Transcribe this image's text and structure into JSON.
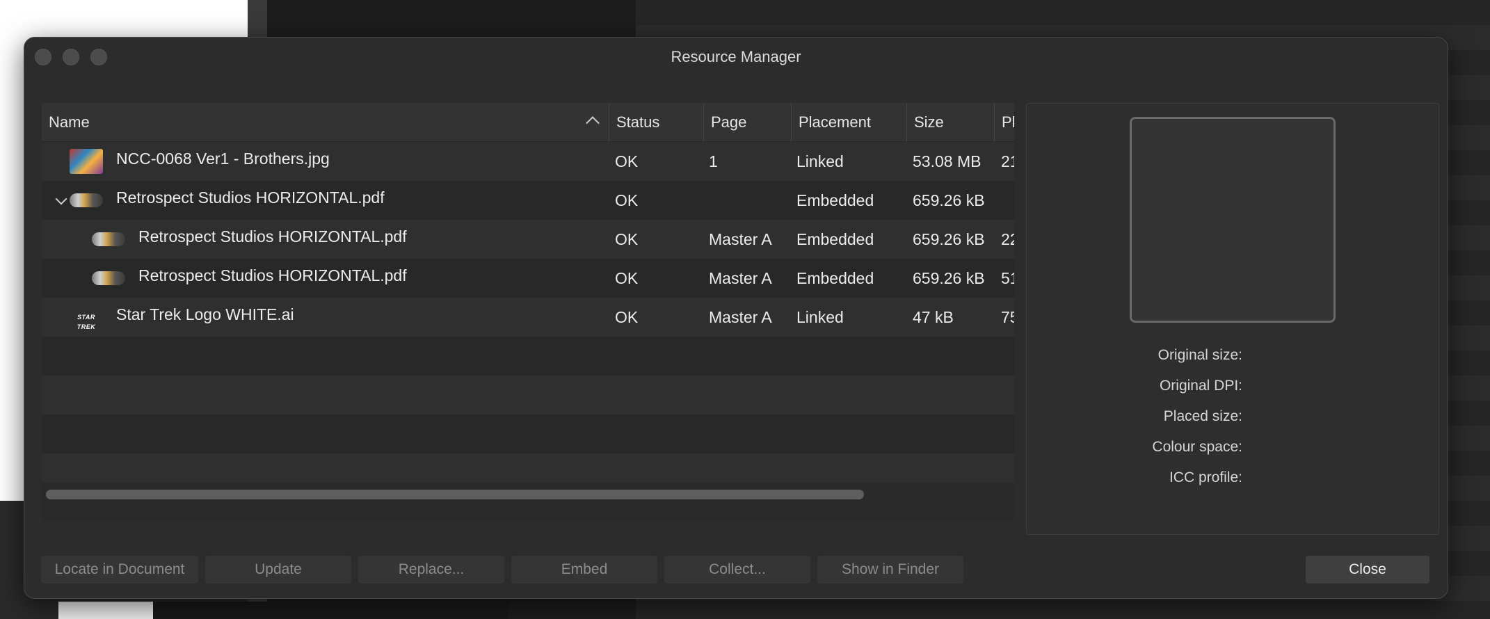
{
  "window": {
    "title": "Resource Manager"
  },
  "table": {
    "headers": {
      "name": "Name",
      "status": "Status",
      "page": "Page",
      "placement": "Placement",
      "size": "Size",
      "extra": "Pl"
    },
    "rows": [
      {
        "name": "NCC-0068 Ver1 - Brothers.jpg",
        "status": "OK",
        "page": "1",
        "placement": "Linked",
        "size": "53.08 MB",
        "extra": "21",
        "thumb": "photo-thumbnail"
      },
      {
        "name": "Retrospect Studios HORIZONTAL.pdf",
        "status": "OK",
        "page": "",
        "placement": "Embedded",
        "size": "659.26 kB",
        "extra": "",
        "thumb": "logo-thumbnail"
      },
      {
        "name": "Retrospect Studios HORIZONTAL.pdf",
        "status": "OK",
        "page": "Master A",
        "placement": "Embedded",
        "size": "659.26 kB",
        "extra": "22",
        "thumb": "logo-thumbnail"
      },
      {
        "name": "Retrospect Studios HORIZONTAL.pdf",
        "status": "OK",
        "page": "Master A",
        "placement": "Embedded",
        "size": "659.26 kB",
        "extra": "51",
        "thumb": "logo-thumbnail"
      },
      {
        "name": "Star Trek Logo WHITE.ai",
        "status": "OK",
        "page": "Master A",
        "placement": "Linked",
        "size": "47 kB",
        "extra": "75",
        "thumb": "star-trek-thumbnail",
        "thumb_text": "STAR TREK"
      }
    ]
  },
  "info": {
    "original_size": "Original size:",
    "original_dpi": "Original DPI:",
    "placed_size": "Placed size:",
    "colour_space": "Colour space:",
    "icc_profile": "ICC profile:"
  },
  "buttons": {
    "locate": "Locate in Document",
    "update": "Update",
    "replace": "Replace...",
    "embed": "Embed",
    "collect": "Collect...",
    "show_in_finder": "Show in Finder",
    "close": "Close"
  },
  "colors": {
    "window_bg": "#2c2c2c",
    "header_bg": "#333333",
    "row_alt": "#2f2f2f",
    "text": "#ececec",
    "disabled_text": "#8c8c8c"
  }
}
